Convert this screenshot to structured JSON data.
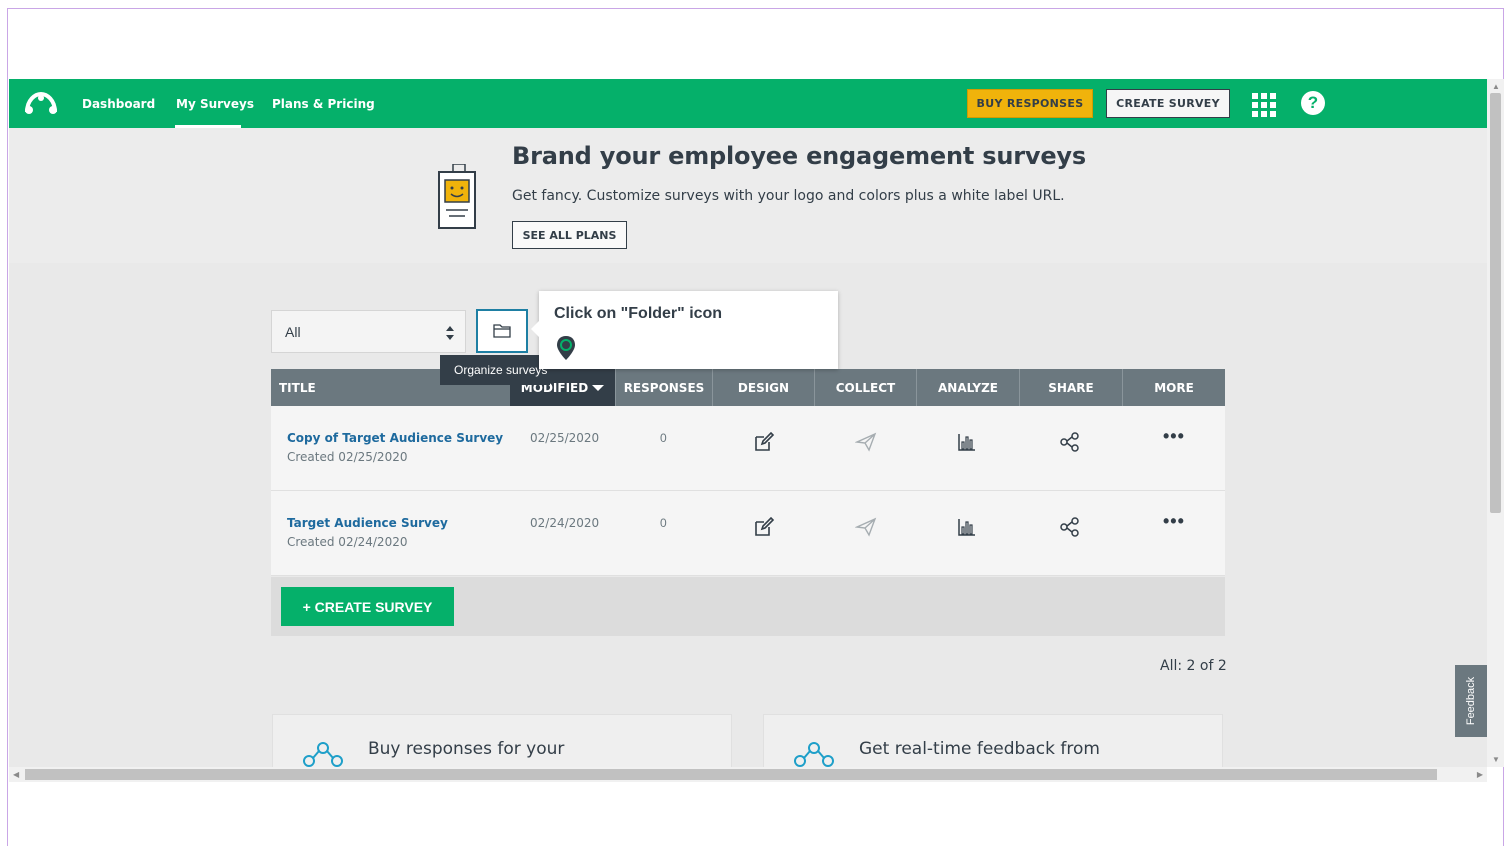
{
  "nav": {
    "links": [
      "Dashboard",
      "My Surveys",
      "Plans & Pricing"
    ],
    "buy_label": "BUY RESPONSES",
    "create_label": "CREATE SURVEY",
    "help_label": "?",
    "brand_color": "#05b06a"
  },
  "banner": {
    "title": "Brand your employee engagement surveys",
    "subtitle": "Get fancy. Customize surveys with your logo and colors plus a white label URL.",
    "cta": "SEE ALL PLANS"
  },
  "filter": {
    "value": "All",
    "folder_tooltip": "Organize surveys"
  },
  "guide": {
    "text": "Click on \"Folder\" icon"
  },
  "table": {
    "headers": {
      "title": "TITLE",
      "modified": "MODIFIED",
      "responses": "RESPONSES",
      "design": "DESIGN",
      "collect": "COLLECT",
      "analyze": "ANALYZE",
      "share": "SHARE",
      "more": "MORE"
    },
    "rows": [
      {
        "name": "Copy of Target Audience Survey",
        "created": "Created 02/25/2020",
        "modified": "02/25/2020",
        "responses": "0"
      },
      {
        "name": "Target Audience Survey",
        "created": "Created 02/24/2020",
        "modified": "02/24/2020",
        "responses": "0"
      }
    ],
    "create_label": "+ CREATE SURVEY"
  },
  "count": "All: 2 of 2",
  "cards": [
    {
      "text": "Buy responses for your"
    },
    {
      "text": "Get real-time feedback from"
    }
  ],
  "feedback_label": "Feedback"
}
